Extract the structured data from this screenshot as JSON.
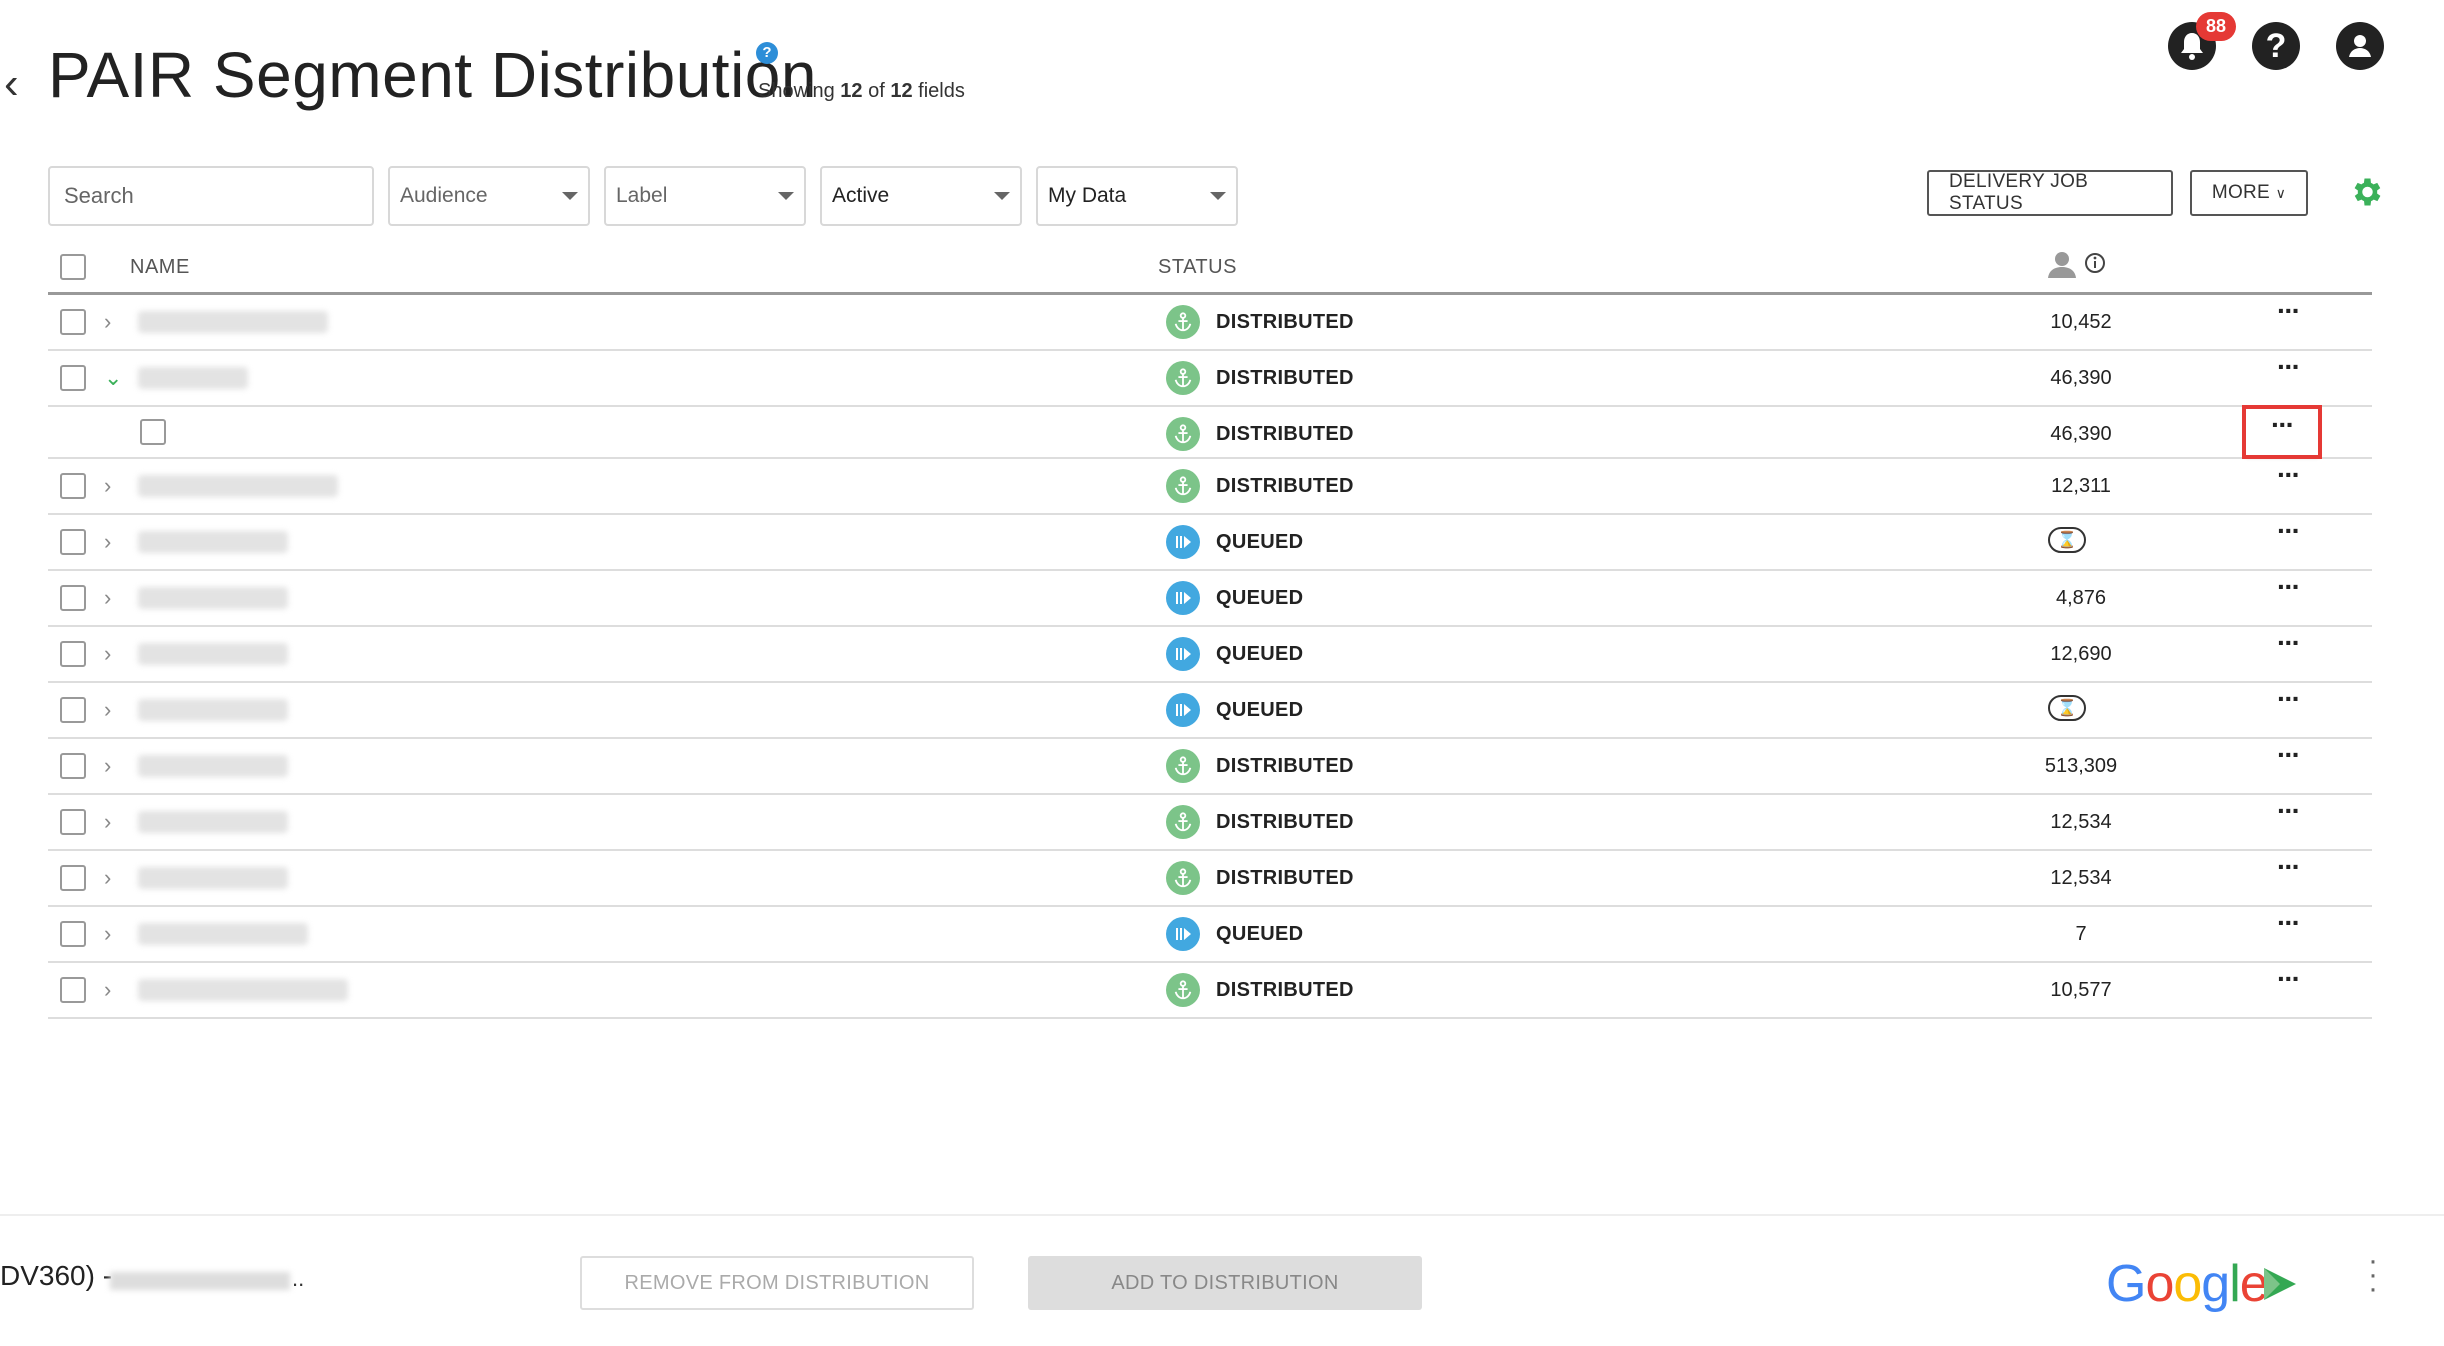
{
  "header": {
    "title": "PAIR Segment Distribution",
    "help_icon": "?",
    "showing_prefix": "Showing",
    "showing_count": "12",
    "showing_of": "of",
    "showing_total": "12",
    "showing_suffix": "fields",
    "notification_count": "88"
  },
  "filters": {
    "search_placeholder": "Search",
    "audience": "Audience",
    "label": "Label",
    "active": "Active",
    "data": "My Data"
  },
  "actions": {
    "delivery_job_status": "DELIVERY JOB STATUS",
    "more": "MORE"
  },
  "table": {
    "col_name": "NAME",
    "col_status": "STATUS",
    "rows": [
      {
        "status": "DISTRIBUTED",
        "type": "dist",
        "count": "10,452",
        "expand": "closed",
        "blur_w": 190
      },
      {
        "status": "DISTRIBUTED",
        "type": "dist",
        "count": "46,390",
        "expand": "open",
        "blur_w": 110
      },
      {
        "status": "DISTRIBUTED",
        "type": "dist",
        "count": "46,390",
        "expand": "child",
        "blur_w": 0,
        "highlight": true
      },
      {
        "status": "DISTRIBUTED",
        "type": "dist",
        "count": "12,311",
        "expand": "closed",
        "blur_w": 200
      },
      {
        "status": "QUEUED",
        "type": "queue",
        "count": "",
        "pending": true,
        "expand": "closed",
        "blur_w": 150
      },
      {
        "status": "QUEUED",
        "type": "queue",
        "count": "4,876",
        "expand": "closed",
        "blur_w": 150
      },
      {
        "status": "QUEUED",
        "type": "queue",
        "count": "12,690",
        "expand": "closed",
        "blur_w": 150
      },
      {
        "status": "QUEUED",
        "type": "queue",
        "count": "",
        "pending": true,
        "expand": "closed",
        "blur_w": 150
      },
      {
        "status": "DISTRIBUTED",
        "type": "dist",
        "count": "513,309",
        "expand": "closed",
        "blur_w": 150
      },
      {
        "status": "DISTRIBUTED",
        "type": "dist",
        "count": "12,534",
        "expand": "closed",
        "blur_w": 150
      },
      {
        "status": "DISTRIBUTED",
        "type": "dist",
        "count": "12,534",
        "expand": "closed",
        "blur_w": 150
      },
      {
        "status": "QUEUED",
        "type": "queue",
        "count": "7",
        "expand": "closed",
        "blur_w": 170
      },
      {
        "status": "DISTRIBUTED",
        "type": "dist",
        "count": "10,577",
        "expand": "closed",
        "blur_w": 210
      }
    ]
  },
  "footer": {
    "label": "DV360) -",
    "dots": "..",
    "remove_button": "REMOVE FROM DISTRIBUTION",
    "add_button": "ADD TO DISTRIBUTION",
    "brand": "Google"
  },
  "colors": {
    "distributed": "#7cc489",
    "queued": "#42a8e0",
    "accent_green": "#3bb15a",
    "badge_red": "#e53935"
  },
  "icons": {
    "back": "chevron-left-icon",
    "notification": "bell-icon",
    "help": "question-icon",
    "account": "user-icon",
    "settings": "gear-icon",
    "audience_size": "person-icon",
    "info": "info-icon",
    "distributed": "anchor-icon",
    "queued": "play-queue-icon",
    "pending": "hourglass-icon",
    "row_menu": "ellipsis-icon",
    "footer_menu": "kebab-icon"
  }
}
